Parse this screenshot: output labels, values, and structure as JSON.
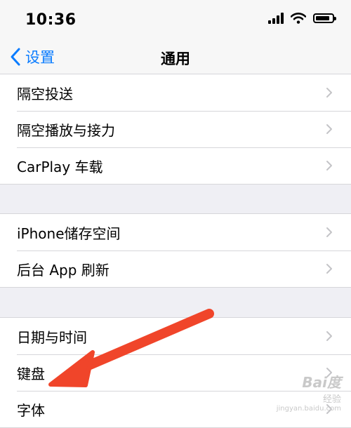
{
  "status_bar": {
    "time": "10:36",
    "icons": [
      "signal-icon",
      "wifi-icon",
      "battery-icon"
    ],
    "battery_level": 0.85
  },
  "nav": {
    "back_label": "设置",
    "title": "通用",
    "accent_color": "#0a7cff"
  },
  "groups": [
    {
      "items": [
        {
          "label": "隔空投送"
        },
        {
          "label": "隔空播放与接力"
        },
        {
          "label": "CarPlay 车载"
        }
      ]
    },
    {
      "items": [
        {
          "label": "iPhone储存空间"
        },
        {
          "label": "后台 App 刷新"
        }
      ]
    },
    {
      "items": [
        {
          "label": "日期与时间"
        },
        {
          "label": "键盘"
        },
        {
          "label": "字体"
        }
      ]
    }
  ],
  "annotation": {
    "icon": "red-arrow-icon",
    "color": "#f0452a",
    "points_to": "键盘"
  },
  "watermark": {
    "brand": "Bai度",
    "sub": "经验",
    "url": "jingyan.baidu.com"
  }
}
